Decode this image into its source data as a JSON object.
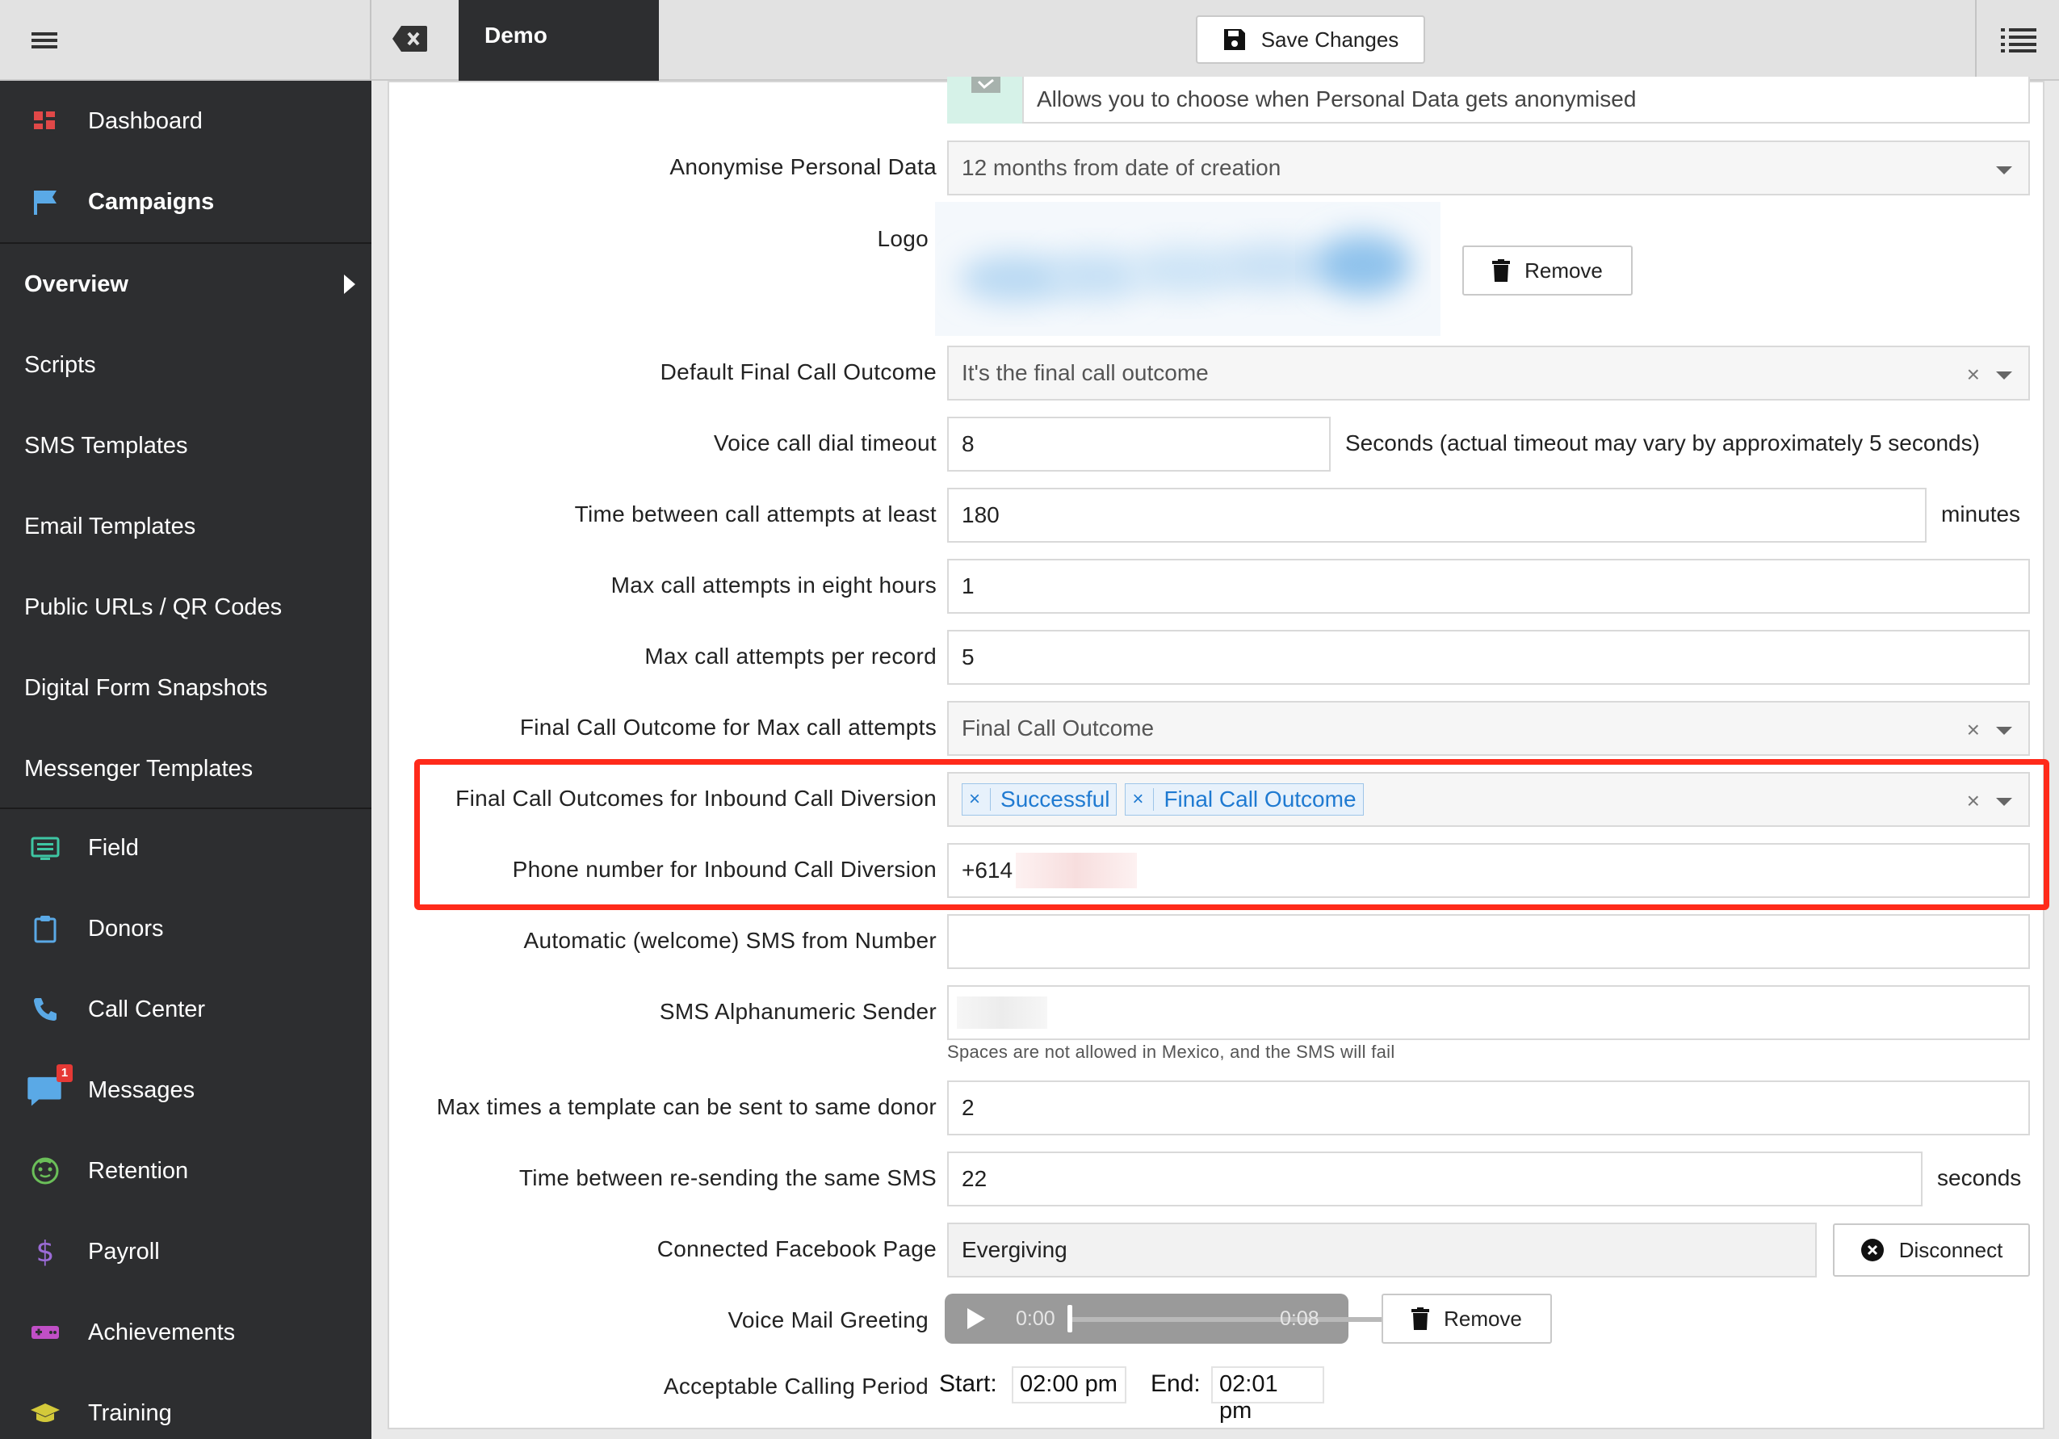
{
  "topbar": {
    "tab_label": "Demo",
    "save_label": "Save Changes"
  },
  "sidebar": {
    "main_items": [
      {
        "label": "Dashboard",
        "icon": "dashboard-icon",
        "color": "#e04848"
      },
      {
        "label": "Campaigns",
        "icon": "flag-icon",
        "color": "#5aa9e6"
      }
    ],
    "sub_items": [
      {
        "label": "Overview"
      },
      {
        "label": "Scripts"
      },
      {
        "label": "SMS Templates"
      },
      {
        "label": "Email Templates"
      },
      {
        "label": "Public URLs / QR Codes"
      },
      {
        "label": "Digital Form Snapshots"
      },
      {
        "label": "Messenger Templates"
      }
    ],
    "bottom_items": [
      {
        "label": "Field",
        "icon": "monitor-icon",
        "color": "#3ec6a3"
      },
      {
        "label": "Donors",
        "icon": "clipboard-icon",
        "color": "#5aa9e6"
      },
      {
        "label": "Call Center",
        "icon": "phone-icon",
        "color": "#5aa9e6"
      },
      {
        "label": "Messages",
        "icon": "chat-icon",
        "color": "#5aa9e6",
        "badge": "1"
      },
      {
        "label": "Retention",
        "icon": "face-icon",
        "color": "#6bbf59"
      },
      {
        "label": "Payroll",
        "icon": "dollar-icon",
        "color": "#9b6bd6"
      },
      {
        "label": "Achievements",
        "icon": "gamepad-icon",
        "color": "#c04fc6"
      },
      {
        "label": "Training",
        "icon": "graduation-cap-icon",
        "color": "#d3c93a"
      }
    ]
  },
  "form": {
    "anonymise_info": "Allows you to choose when Personal Data gets anonymised",
    "anonymise_label": "Anonymise Personal Data",
    "anonymise_value": "12 months from date of creation",
    "logo_label": "Logo",
    "remove_label": "Remove",
    "default_outcome_label": "Default Final Call Outcome",
    "default_outcome_value": "It's the final call outcome",
    "dial_timeout_label": "Voice call dial timeout",
    "dial_timeout_value": "8",
    "dial_timeout_suffix": "Seconds (actual timeout may vary by approximately 5 seconds)",
    "time_between_label": "Time between call attempts at least",
    "time_between_value": "180",
    "time_between_suffix": "minutes",
    "max_eight_hours_label": "Max call attempts in eight hours",
    "max_eight_hours_value": "1",
    "max_per_record_label": "Max call attempts per record",
    "max_per_record_value": "5",
    "max_outcome_label": "Final Call Outcome for Max call attempts",
    "max_outcome_value": "Final Call Outcome",
    "inbound_outcomes_label": "Final Call Outcomes for Inbound Call Diversion",
    "inbound_outcomes_tags": [
      "Successful",
      "Final Call Outcome"
    ],
    "inbound_phone_label": "Phone number for Inbound Call Diversion",
    "inbound_phone_value": "+614",
    "welcome_sms_label": "Automatic (welcome) SMS from Number",
    "welcome_sms_value": "",
    "alpha_sender_label": "SMS Alphanumeric Sender",
    "alpha_sender_hint": "Spaces are not allowed in Mexico, and the SMS will fail",
    "max_template_label": "Max times a template can be sent to same donor",
    "max_template_value": "2",
    "resend_label": "Time between re-sending the same SMS",
    "resend_value": "22",
    "resend_suffix": "seconds",
    "facebook_label": "Connected Facebook Page",
    "facebook_value": "Evergiving",
    "disconnect_label": "Disconnect",
    "voicemail_label": "Voice Mail Greeting",
    "audio_current": "0:00",
    "audio_duration": "0:08",
    "audio_progress": 0,
    "calling_period_label": "Acceptable Calling Period",
    "start_label": "Start:",
    "start_value": "02:00 pm",
    "end_label": "End:",
    "end_value": "02:01 pm"
  },
  "colors": {
    "highlight": "#ff2a1a",
    "sidebar_bg": "#2d2e30",
    "tag_text": "#1f7ad1"
  }
}
